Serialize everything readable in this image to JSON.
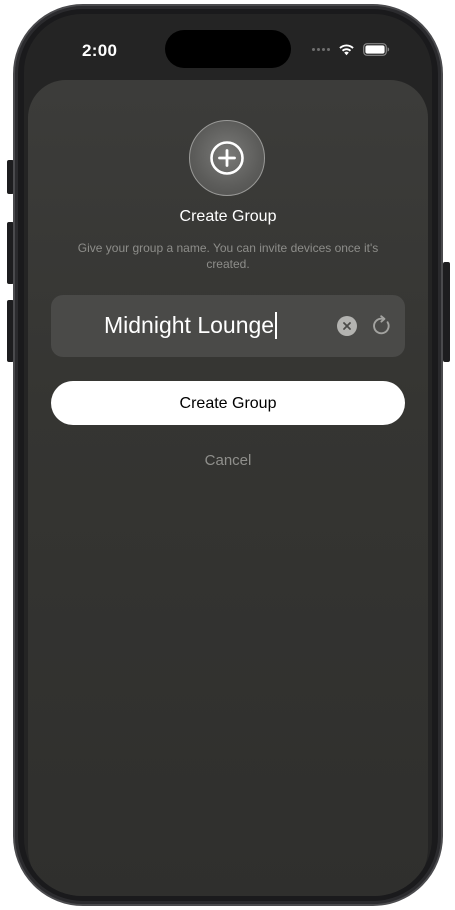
{
  "status_bar": {
    "time": "2:00"
  },
  "sheet": {
    "title": "Create Group",
    "subtitle": "Give your group a name. You can invite devices once it's created.",
    "badge_icon": "plus-circle-icon"
  },
  "name_field": {
    "value": "Midnight Lounge",
    "clear_icon": "clear-icon",
    "refresh_icon": "refresh-icon"
  },
  "actions": {
    "create_label": "Create Group",
    "cancel_label": "Cancel"
  },
  "colors": {
    "sheet_background": "#353532",
    "field_background": "#4a4a48",
    "primary_button": "#ffffff",
    "secondary_text": "#8d8d8a"
  }
}
